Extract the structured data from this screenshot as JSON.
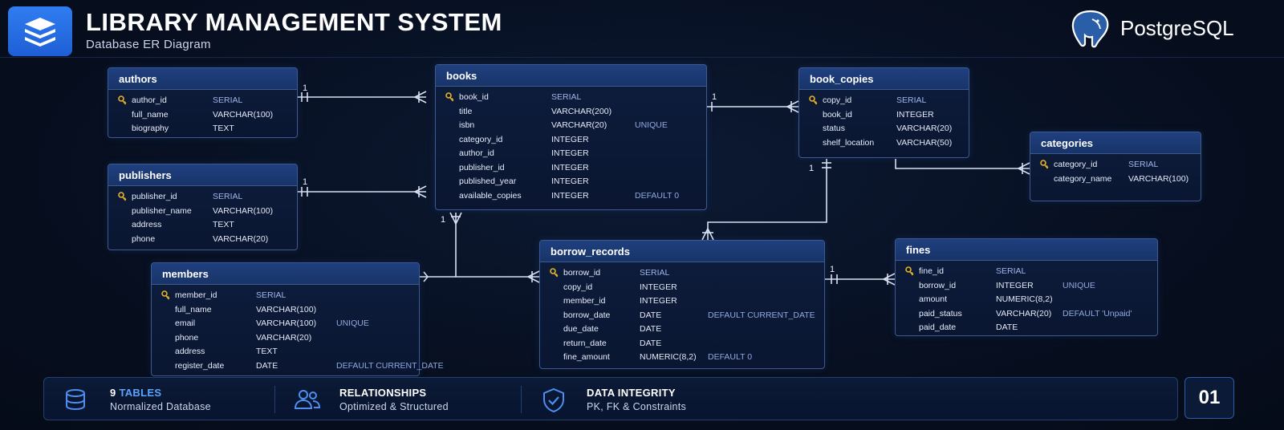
{
  "header": {
    "title": "LIBRARY MANAGEMENT SYSTEM",
    "subtitle": "Database ER Diagram",
    "brand": "PostgreSQL"
  },
  "colors": {
    "accent": "#5aa4ff",
    "pk_key": "#e6b422",
    "table_border": "#3d5a90",
    "link_line": "#d9e1f2"
  },
  "tables": {
    "authors": {
      "name": "authors",
      "rows": [
        {
          "field": "author_id",
          "type": "SERIAL",
          "extra": "",
          "pk": true
        },
        {
          "field": "full_name",
          "type": "VARCHAR(100)",
          "extra": "",
          "pk": false
        },
        {
          "field": "biography",
          "type": "TEXT",
          "extra": "",
          "pk": false
        }
      ]
    },
    "publishers": {
      "name": "publishers",
      "rows": [
        {
          "field": "publisher_id",
          "type": "SERIAL",
          "extra": "",
          "pk": true
        },
        {
          "field": "publisher_name",
          "type": "VARCHAR(100)",
          "extra": "",
          "pk": false
        },
        {
          "field": "address",
          "type": "TEXT",
          "extra": "",
          "pk": false
        },
        {
          "field": "phone",
          "type": "VARCHAR(20)",
          "extra": "",
          "pk": false
        }
      ]
    },
    "members": {
      "name": "members",
      "rows": [
        {
          "field": "member_id",
          "type": "SERIAL",
          "extra": "",
          "pk": true
        },
        {
          "field": "full_name",
          "type": "VARCHAR(100)",
          "extra": "",
          "pk": false
        },
        {
          "field": "email",
          "type": "VARCHAR(100)",
          "extra": "UNIQUE",
          "pk": false
        },
        {
          "field": "phone",
          "type": "VARCHAR(20)",
          "extra": "",
          "pk": false
        },
        {
          "field": "address",
          "type": "TEXT",
          "extra": "",
          "pk": false
        },
        {
          "field": "register_date",
          "type": "DATE",
          "extra": "DEFAULT CURRENT_DATE",
          "pk": false
        }
      ]
    },
    "books": {
      "name": "books",
      "rows": [
        {
          "field": "book_id",
          "type": "SERIAL",
          "extra": "",
          "pk": true
        },
        {
          "field": "title",
          "type": "VARCHAR(200)",
          "extra": "",
          "pk": false
        },
        {
          "field": "isbn",
          "type": "VARCHAR(20)",
          "extra": "UNIQUE",
          "pk": false
        },
        {
          "field": "category_id",
          "type": "INTEGER",
          "extra": "",
          "pk": false
        },
        {
          "field": "author_id",
          "type": "INTEGER",
          "extra": "",
          "pk": false
        },
        {
          "field": "publisher_id",
          "type": "INTEGER",
          "extra": "",
          "pk": false
        },
        {
          "field": "published_year",
          "type": "INTEGER",
          "extra": "",
          "pk": false
        },
        {
          "field": "available_copies",
          "type": "INTEGER",
          "extra": "DEFAULT 0",
          "pk": false
        }
      ]
    },
    "book_copies": {
      "name": "book_copies",
      "rows": [
        {
          "field": "copy_id",
          "type": "SERIAL",
          "extra": "",
          "pk": true
        },
        {
          "field": "book_id",
          "type": "INTEGER",
          "extra": "",
          "pk": false
        },
        {
          "field": "status",
          "type": "VARCHAR(20)",
          "extra": "",
          "pk": false
        },
        {
          "field": "shelf_location",
          "type": "VARCHAR(50)",
          "extra": "",
          "pk": false
        }
      ]
    },
    "categories": {
      "name": "categories",
      "rows": [
        {
          "field": "category_id",
          "type": "SERIAL",
          "extra": "",
          "pk": true
        },
        {
          "field": "category_name",
          "type": "VARCHAR(100)",
          "extra": "",
          "pk": false
        }
      ]
    },
    "borrow_records": {
      "name": "borrow_records",
      "rows": [
        {
          "field": "borrow_id",
          "type": "SERIAL",
          "extra": "",
          "pk": true
        },
        {
          "field": "copy_id",
          "type": "INTEGER",
          "extra": "",
          "pk": false
        },
        {
          "field": "member_id",
          "type": "INTEGER",
          "extra": "",
          "pk": false
        },
        {
          "field": "borrow_date",
          "type": "DATE",
          "extra": "DEFAULT CURRENT_DATE",
          "pk": false
        },
        {
          "field": "due_date",
          "type": "DATE",
          "extra": "",
          "pk": false
        },
        {
          "field": "return_date",
          "type": "DATE",
          "extra": "",
          "pk": false
        },
        {
          "field": "fine_amount",
          "type": "NUMERIC(8,2)",
          "extra": "DEFAULT 0",
          "pk": false
        }
      ]
    },
    "fines": {
      "name": "fines",
      "rows": [
        {
          "field": "fine_id",
          "type": "SERIAL",
          "extra": "",
          "pk": true
        },
        {
          "field": "borrow_id",
          "type": "INTEGER",
          "extra": "UNIQUE",
          "pk": false
        },
        {
          "field": "amount",
          "type": "NUMERIC(8,2)",
          "extra": "",
          "pk": false
        },
        {
          "field": "paid_status",
          "type": "VARCHAR(20)",
          "extra": "DEFAULT 'Unpaid'",
          "pk": false
        },
        {
          "field": "paid_date",
          "type": "DATE",
          "extra": "",
          "pk": false
        }
      ]
    }
  },
  "cardinality": {
    "one": "1"
  },
  "footer": {
    "tables_count": "9",
    "tables_word": "TABLES",
    "tables_sub": "Normalized Database",
    "rel_title": "RELATIONSHIPS",
    "rel_sub": "Optimized & Structured",
    "integrity_title": "DATA INTEGRITY",
    "integrity_sub": "PK, FK & Constraints",
    "page_number": "01"
  }
}
